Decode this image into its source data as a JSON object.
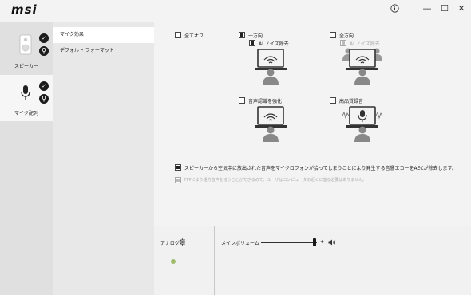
{
  "app": {
    "logo": "msi"
  },
  "titlebar": {
    "info_icon": "info-icon",
    "minimize": "—",
    "maximize": "☐",
    "close": "✕"
  },
  "devices": [
    {
      "label": "スピーカー",
      "icon": "speaker-icon"
    },
    {
      "label": "マイク配列",
      "icon": "microphone-icon"
    }
  ],
  "menu": {
    "items": [
      {
        "label": "マイク効果"
      },
      {
        "label": "デフォルト フォーマット"
      }
    ]
  },
  "effects": {
    "all_off": "全てオフ",
    "unidirectional": "一方向",
    "ai_noise_uni": "AI ノイズ除去",
    "omnidirectional": "全方向",
    "ai_noise_omni": "AI ノイズ除去",
    "voice_recognition": "音声認識を強化",
    "high_quality_recording": "高品質録音"
  },
  "aec": {
    "text": "スピーカーから空気中に放出された音声をマイクロフォンが拾ってしまうことにより発生する音響エコーをAECが除去します。",
    "ffp_text": "FFPにより遠方音声を拾うことができるので、ユーザはコンピュータの近くに座る必要はありません。"
  },
  "bottom": {
    "analog_label": "アナログ",
    "volume_label": "メインボリューム",
    "minus": "–",
    "plus": "+"
  },
  "controls": {
    "volume_level": 0.95
  },
  "colors": {
    "status_dot": "#9fba6a"
  }
}
